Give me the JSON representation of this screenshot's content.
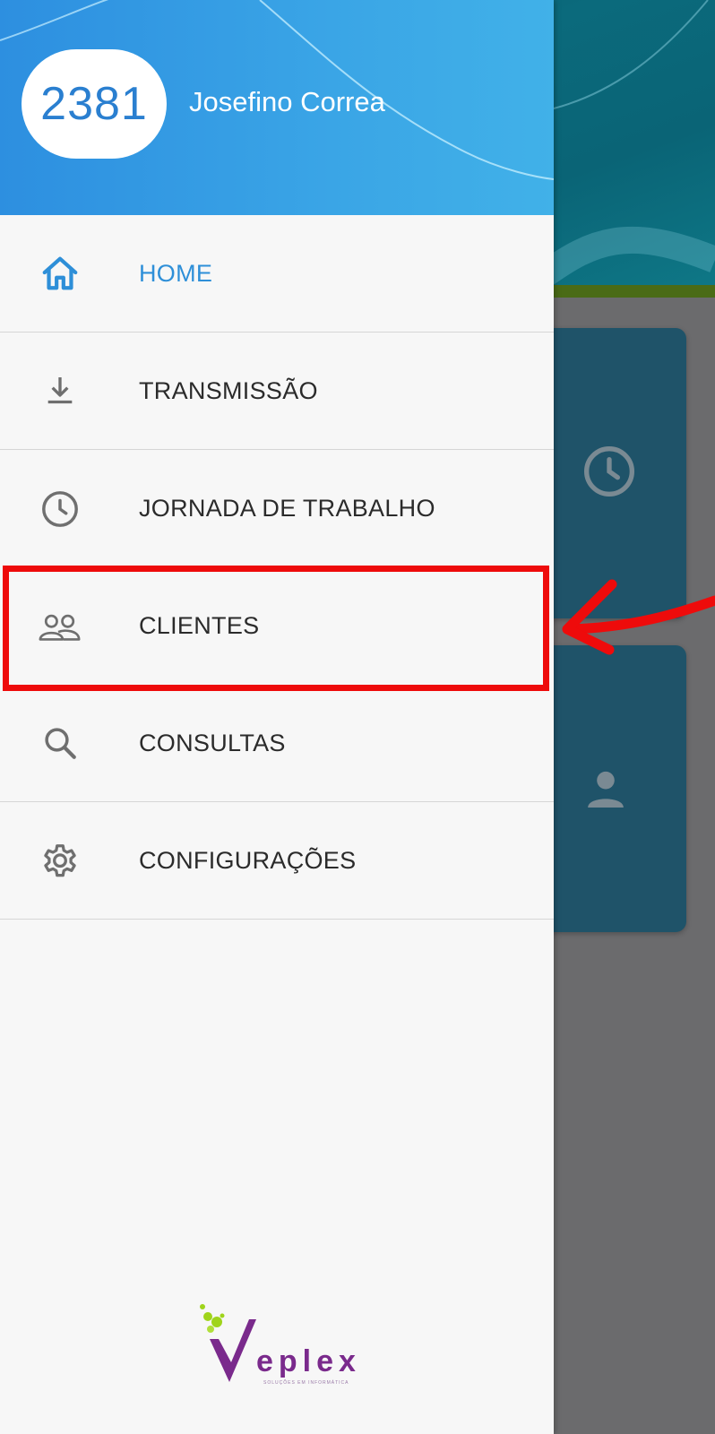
{
  "user": {
    "code": "2381",
    "name": "Josefino Correa"
  },
  "menu": {
    "items": [
      {
        "label": "HOME",
        "icon": "home-icon",
        "active": true
      },
      {
        "label": "TRANSMISSÃO",
        "icon": "download-icon",
        "active": false
      },
      {
        "label": "JORNADA DE TRABALHO",
        "icon": "clock-icon",
        "active": false
      },
      {
        "label": "CLIENTES",
        "icon": "people-icon",
        "active": false
      },
      {
        "label": "CONSULTAS",
        "icon": "search-icon",
        "active": false
      },
      {
        "label": "CONFIGURAÇÕES",
        "icon": "gear-icon",
        "active": false
      }
    ]
  },
  "logo": {
    "text": "eplex",
    "tagline": "SOLUÇÕES EM INFORMÁTICA"
  },
  "background_cards": [
    {
      "icon": "clock-icon"
    },
    {
      "icon": "person-icon"
    }
  ],
  "annotation": {
    "highlight_color": "#ee0b0b",
    "target": "CLIENTES"
  },
  "colors": {
    "accent": "#2e8fd8",
    "header_gradient_start": "#2d8fe0",
    "header_gradient_end": "#41b1e8",
    "scrim": "#6b6b6d",
    "card": "#1f5369",
    "logo_purple": "#7a2a8c",
    "logo_green": "#9fd41b"
  }
}
